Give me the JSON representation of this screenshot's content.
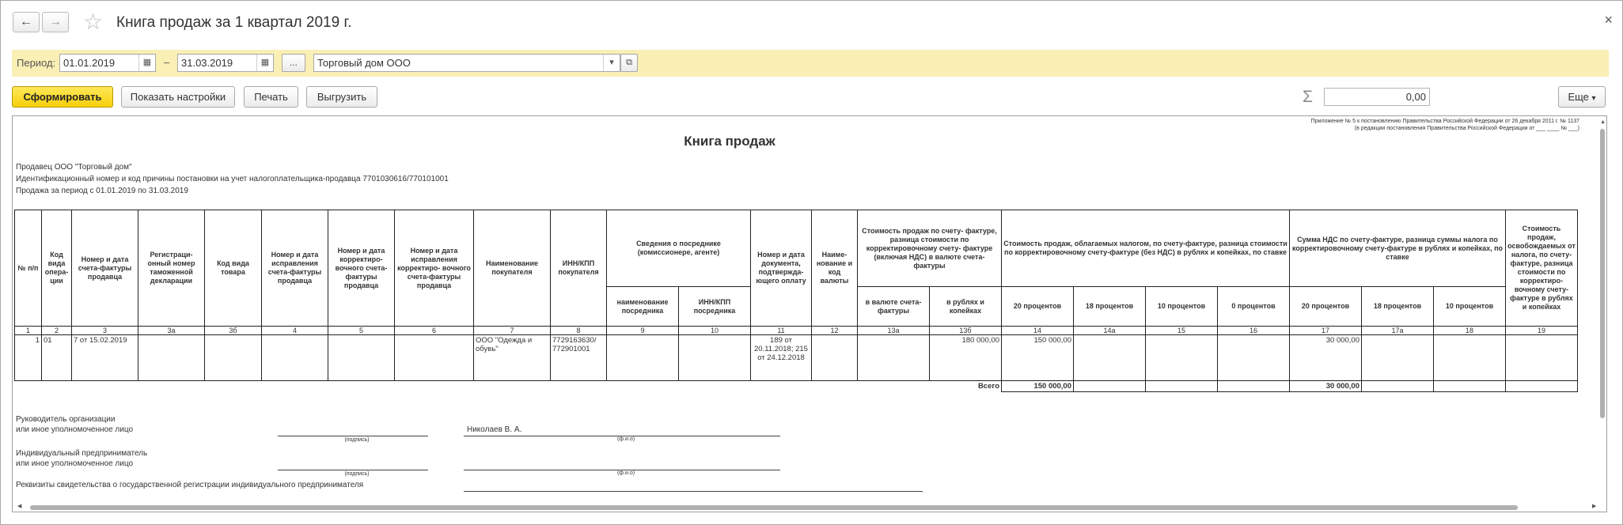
{
  "window": {
    "title": "Книга продаж за 1 квартал 2019 г.",
    "back_icon": "←",
    "forward_icon": "→",
    "star_icon": "☆",
    "close_icon": "×"
  },
  "filters": {
    "period_label": "Период:",
    "date_from": "01.01.2019",
    "dash": "–",
    "date_to": "31.03.2019",
    "ellipsis": "...",
    "organization": "Торговый дом ООО",
    "calendar_icon": "▦",
    "dropdown_icon": "▾",
    "open_icon": "⧉"
  },
  "toolbar": {
    "generate": "Сформировать",
    "settings": "Показать настройки",
    "print": "Печать",
    "export": "Выгрузить",
    "sigma": "Σ",
    "sum_value": "0,00",
    "more": "Еще",
    "more_icon": "▾"
  },
  "report": {
    "appendix_line1": "Приложение № 5 к постановлению Правительства Российской Федерации от 26 декабря 2011 г. № 1137",
    "appendix_line2": "(в редакции постановления Правительства Российской Федерации от ___ ____ № ___)",
    "title": "Книга продаж",
    "seller": "Продавец  ООО \"Торговый дом\"",
    "inn_line": "Идентификационный номер и код причины постановки на учет налогоплательщика-продавца  7701030616/770101001",
    "period_line": "Продажа за период с 01.01.2019 по 31.03.2019",
    "headers": {
      "h1": "№ п/п",
      "h2": "Код вида опера- ции",
      "h3": "Номер и дата счета-фактуры продавца",
      "h3a": "Регистраци- онный номер таможенной декларации",
      "h3b": "Код вида товара",
      "h4": "Номер и дата исправления счета-фактуры продавца",
      "h5": "Номер и дата корректиро- вочного счета-фактуры продавца",
      "h6": "Номер и дата исправления корректиро- вочного счета-фактуры продавца",
      "h7": "Наименование покупателя",
      "h8": "ИНН/КПП покупателя",
      "h_inter": "Сведения о посреднике (комиссионере, агенте)",
      "h9": "наименование посредника",
      "h10": "ИНН/КПП посредника",
      "h11": "Номер и дата документа, подтвержда- ющего оплату",
      "h12": "Наиме- нование и код валюты",
      "h13": "Стоимость продаж по счету- фактуре, разница стоимости по корректировочному счету- фактуре (включая НДС) в валюте счета-фактуры",
      "h13a": "в валюте счета-фактуры",
      "h13b": "в рублях и копейках",
      "h14grp": "Стоимость продаж, облагаемых налогом, по счету-фактуре, разница стоимости по корректировочному счету-фактуре (без НДС) в рублях и копейках, по ставке",
      "h14": "20 процентов",
      "h14a": "18 процентов",
      "h15": "10 процентов",
      "h16": "0 процентов",
      "h17grp": "Сумма НДС по счету-фактуре, разница суммы налога по корректировочному счету-фактуре в рублях и копейках, по ставке",
      "h17": "20 процентов",
      "h17a": "18 процентов",
      "h18": "10 процентов",
      "h19": "Стоимость продаж, освобождаемых от налога, по счету-фактуре, разница стоимости по корректиро- вочному счету-фактуре в рублях и копейках"
    },
    "col_numbers": [
      "1",
      "2",
      "3",
      "3а",
      "3б",
      "4",
      "5",
      "6",
      "7",
      "8",
      "9",
      "10",
      "11",
      "12",
      "13а",
      "13б",
      "14",
      "14а",
      "15",
      "16",
      "17",
      "17а",
      "18",
      "19"
    ],
    "row": {
      "n": "1",
      "op_code": "01",
      "invoice": "7 от 15.02.2019",
      "buyer": "ООО \"Одежда и обувь\"",
      "buyer_inn": "7729163630/ 772901001",
      "payment_doc": "189 от 20.11.2018; 215 от 24.12.2018",
      "total_rub": "180 000,00",
      "base20": "150 000,00",
      "vat20": "30 000,00"
    },
    "total": {
      "label": "Всего",
      "base20": "150 000,00",
      "vat20": "30 000,00"
    },
    "signatures": {
      "head_line1": "Руководитель организации",
      "head_line2": "или иное уполномоченное лицо",
      "head_name": "Николаев В. А.",
      "cap_sign": "(подпись)",
      "cap_fio": "(ф.и.о)",
      "ip_line1": "Индивидуальный предприниматель",
      "ip_line2": "или иное уполномоченное лицо",
      "cap_sign2": "(подпись)",
      "cap_fio2": "(ф.и.о)",
      "registration": "Реквизиты свидетельства о государственной регистрации индивидуального предпринимателя"
    }
  }
}
